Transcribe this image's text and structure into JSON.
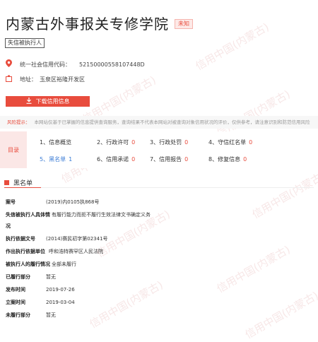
{
  "company": {
    "name": "内蒙古外事报关专修学院",
    "badge": "未知",
    "tag": "失信被执行人",
    "credit_code_label": "统一社会信用代码：",
    "credit_code": "52150000558107448D",
    "address_label": "地址：",
    "address": "玉泉区裕隆开发区"
  },
  "actions": {
    "download_label": "下载信用信息"
  },
  "risk": {
    "label": "风险提示：",
    "text": "本网站仅基于已掌握的信息提供查询服务，查询结果不代表本网站对被查询对象信用状况的评价，仅供参考，请注意识别和防范信用风险"
  },
  "menu": {
    "label": "目录",
    "items": [
      {
        "label": "1、信息概览",
        "count": ""
      },
      {
        "label": "2、行政许可",
        "count": "0"
      },
      {
        "label": "3、行政处罚",
        "count": "0"
      },
      {
        "label": "4、守信红名单",
        "count": "0"
      },
      {
        "label": "5、黑名单",
        "count": "1"
      },
      {
        "label": "6、信用承诺",
        "count": "0"
      },
      {
        "label": "7、信用报告",
        "count": "0"
      },
      {
        "label": "8、修复信息",
        "count": "0"
      }
    ]
  },
  "blacklist": {
    "section_title": "黑名单",
    "case_no_label": "案号",
    "case_no": "(2019)内0105执868号",
    "situation_label": "失信被执行人具体情",
    "situation_label2": "况",
    "situation": "有履行能力而拒不履行生效法律文书确定义务",
    "basis_no_label": "执行依据文号",
    "basis_no": "(2014)赛民初字第02341号",
    "court_label": "作出执行依据单位",
    "court": "呼和浩特赛罕区人民法院",
    "performance_label": "被执行人的履行情况",
    "performance": "全部未履行",
    "performed_label": "已履行部分",
    "performed": "暂无",
    "publish_label": "发布时间",
    "publish": "2019-07-26",
    "filed_label": "立案时间",
    "filed": "2019-03-04",
    "unperformed_label": "未履行部分",
    "unperformed": "暂无"
  },
  "watermark": {
    "text": "信用中国(内蒙古)"
  },
  "colors": {
    "accent": "#e84c3d",
    "link": "#3a7bd5"
  },
  "icons": {
    "location": "location-pin-icon",
    "address": "address-icon",
    "download": "download-icon"
  }
}
